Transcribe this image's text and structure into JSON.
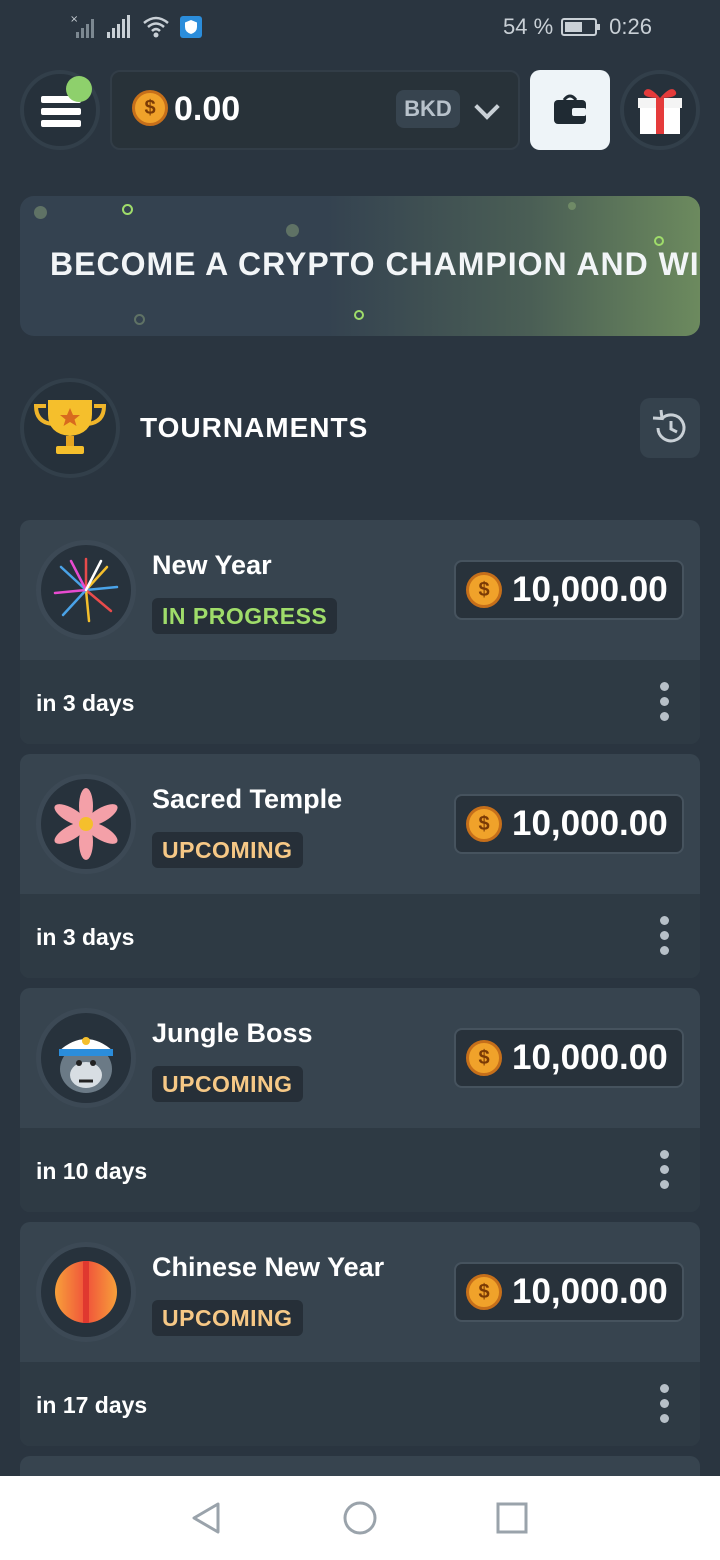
{
  "status_bar": {
    "battery": "54 %",
    "time": "0:26"
  },
  "header": {
    "balance": "0.00",
    "currency": "BKD"
  },
  "banner": {
    "text": "BECOME A CRYPTO CHAMPION AND WIN BIG"
  },
  "section": {
    "title": "TOURNAMENTS"
  },
  "tournaments": [
    {
      "name": "New Year",
      "status": "IN PROGRESS",
      "prize": "10,000.00",
      "when": "in 3 days",
      "status_color": "#9fdc6a",
      "icon": "fireworks-icon"
    },
    {
      "name": "Sacred Temple",
      "status": "UPCOMING",
      "prize": "10,000.00",
      "when": "in 3 days",
      "status_color": "#f6c886",
      "icon": "lotus-flower-icon"
    },
    {
      "name": "Jungle Boss",
      "status": "UPCOMING",
      "prize": "10,000.00",
      "when": "in 10 days",
      "status_color": "#f6c886",
      "icon": "gorilla-captain-icon"
    },
    {
      "name": "Chinese New Year",
      "status": "UPCOMING",
      "prize": "10,000.00",
      "when": "in 17 days",
      "status_color": "#f6c886",
      "icon": "lantern-icon"
    }
  ],
  "colors": {
    "background": "#2a3540",
    "card": "#37444f",
    "accent_green": "#8ed06c",
    "coin": "#f0a22a"
  }
}
